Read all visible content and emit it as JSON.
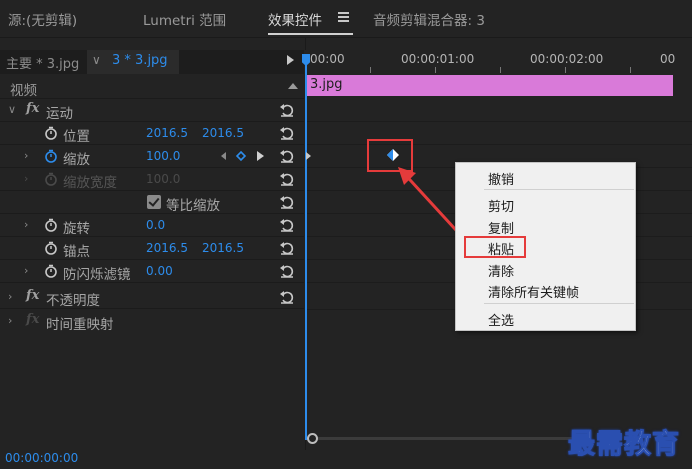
{
  "tabs": {
    "source": "源:(无剪辑)",
    "lumetri": "Lumetri 范围",
    "effect_controls": "效果控件",
    "audio_mixer": "音频剪辑混合器: 3"
  },
  "source_bar": {
    "main_label": "主要 * 3.jpg",
    "clip_label": "3 * 3.jpg"
  },
  "section": {
    "video_label": "视频"
  },
  "effects": {
    "motion": "运动",
    "position": {
      "label": "位置",
      "x": "2016.5",
      "y": "2016.5"
    },
    "scale": {
      "label": "缩放",
      "value": "100.0"
    },
    "scale_width": {
      "label": "缩放宽度",
      "value": "100.0"
    },
    "uniform_scale": {
      "label": "等比缩放",
      "checked": true
    },
    "rotation": {
      "label": "旋转",
      "value": "0.0"
    },
    "anchor": {
      "label": "锚点",
      "x": "2016.5",
      "y": "2016.5"
    },
    "anti_flicker": {
      "label": "防闪烁滤镜",
      "value": "0.00"
    },
    "opacity": "不透明度",
    "time_remap": "时间重映射"
  },
  "timeline": {
    "timecodes": [
      "00:00",
      "00:00:01:00",
      "00:00:02:00",
      "00"
    ],
    "clip_name": "3.jpg"
  },
  "context_menu": {
    "undo": "撤销",
    "cut": "剪切",
    "copy": "复制",
    "paste": "粘贴",
    "clear": "清除",
    "clear_all_keyframes": "清除所有关键帧",
    "select_all": "全选"
  },
  "footer": {
    "timecode": "00:00:00:00"
  },
  "watermark": "最需教育",
  "colors": {
    "accent": "#2d8ceb",
    "clip": "#d97ad9",
    "highlight": "#e53b3b"
  }
}
